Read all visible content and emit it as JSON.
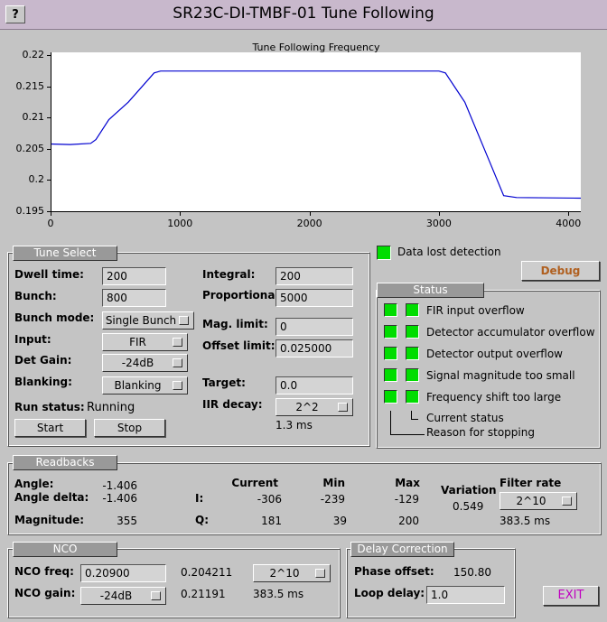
{
  "window": {
    "title": "SR23C-DI-TMBF-01 Tune Following",
    "help_label": "?"
  },
  "plot": {
    "title": "Tune Following Frequency",
    "y_ticks": [
      "0.22",
      "0.215",
      "0.21",
      "0.205",
      "0.2",
      "0.195"
    ],
    "x_ticks": [
      "0",
      "1000",
      "2000",
      "3000",
      "4000"
    ]
  },
  "chart_data": {
    "type": "line",
    "title": "Tune Following Frequency",
    "xlim": [
      0,
      4096
    ],
    "ylim": [
      0.195,
      0.2205
    ],
    "series": [
      {
        "x": [
          0,
          150,
          310,
          350,
          450,
          600,
          800,
          850,
          1500,
          2000,
          2500,
          3000,
          3050,
          3200,
          3400,
          3500,
          3600,
          4096
        ],
        "y": [
          0.2058,
          0.2057,
          0.2059,
          0.2065,
          0.2097,
          0.2125,
          0.2172,
          0.2175,
          0.2175,
          0.2175,
          0.2175,
          0.2175,
          0.2172,
          0.2125,
          0.2025,
          0.1975,
          0.1972,
          0.1971
        ]
      }
    ],
    "color": "#0000d0",
    "grid": false
  },
  "tune_select": {
    "title": "Tune Select",
    "dwell_label": "Dwell time:",
    "dwell_value": "200",
    "bunch_label": "Bunch:",
    "bunch_value": "800",
    "mode_label": "Bunch mode:",
    "mode_value": "Single Bunch",
    "input_label": "Input:",
    "input_value": "FIR",
    "gain_label": "Det Gain:",
    "gain_value": "-24dB",
    "blank_label": "Blanking:",
    "blank_value": "Blanking",
    "run_label": "Run status:",
    "run_value": "Running",
    "start_label": "Start",
    "stop_label": "Stop",
    "integral_label": "Integral:",
    "integral_value": "200",
    "prop_label": "Proportional:",
    "prop_value": "5000",
    "mag_label": "Mag. limit:",
    "mag_value": "0",
    "offset_label": "Offset limit:",
    "offset_value": "0.025000",
    "target_label": "Target:",
    "target_value": "0.0",
    "iir_label": "IIR decay:",
    "iir_value": "2^2",
    "iir_ms": "1.3 ms"
  },
  "data_lost": {
    "label": "Data lost detection",
    "color": "#00dd00"
  },
  "debug_label": "Debug",
  "status": {
    "title": "Status",
    "items": [
      "FIR input overflow",
      "Detector accumulator overflow",
      "Detector output overflow",
      "Signal magnitude too small",
      "Frequency shift too large"
    ],
    "current": "Current status",
    "reason": "Reason for stopping"
  },
  "readbacks": {
    "title": "Readbacks",
    "angle_label": "Angle:",
    "angle_value": "-1.406",
    "delta_label": "Angle delta:",
    "delta_value": "-1.406",
    "mag_label": "Magnitude:",
    "mag_value": "355",
    "h_current": "Current",
    "h_min": "Min",
    "h_max": "Max",
    "i_label": "I:",
    "i_current": "-306",
    "i_min": "-239",
    "i_max": "-129",
    "q_label": "Q:",
    "q_current": "181",
    "q_min": "39",
    "q_max": "200",
    "variation_label": "Variation",
    "variation_value": "0.549",
    "filter_label": "Filter rate",
    "filter_value": "2^10",
    "filter_ms": "383.5 ms"
  },
  "nco": {
    "title": "NCO",
    "freq_label": "NCO freq:",
    "freq_value": "0.20900",
    "freq_readback": "0.204211",
    "gain_label": "NCO gain:",
    "gain_value": "-24dB",
    "gain_readback": "0.21191",
    "rate_value": "2^10",
    "rate_ms": "383.5 ms"
  },
  "delay": {
    "title": "Delay Correction",
    "phase_label": "Phase offset:",
    "phase_value": "150.80",
    "loop_label": "Loop delay:",
    "loop_value": "1.0"
  },
  "exit_label": "EXIT"
}
